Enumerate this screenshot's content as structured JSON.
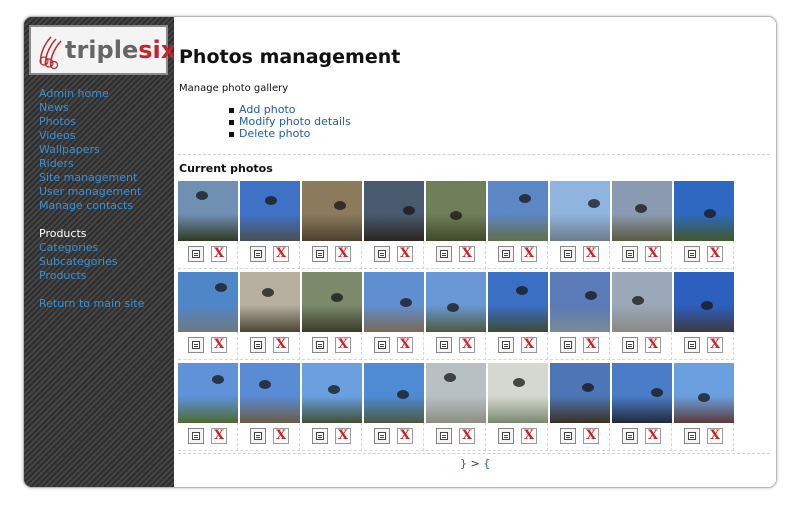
{
  "logo": {
    "text_main": "triple",
    "text_accent": "six"
  },
  "nav": {
    "items": [
      "Admin home",
      "News",
      "Photos",
      "Videos",
      "Wallpapers",
      "Riders",
      "Site management",
      "User management",
      "Manage contacts"
    ],
    "products_heading": "Products",
    "product_items": [
      "Categories",
      "Subcategories",
      "Products"
    ],
    "return_link": "Return to main site"
  },
  "page": {
    "title": "Photos management",
    "subtitle": "Manage photo gallery",
    "actions": [
      "Add photo",
      "Modify photo details",
      "Delete photo"
    ],
    "section_title": "Current photos"
  },
  "photos": {
    "delete_glyph": "X",
    "thumbs": [
      [
        "#6f8fb3",
        "#2f3a22"
      ],
      [
        "#3f72c6",
        "#4a4f55"
      ],
      [
        "#8b7a5c",
        "#4d4030"
      ],
      [
        "#4a5a6e",
        "#2a2520"
      ],
      [
        "#6f7f5a",
        "#3f4a2a"
      ],
      [
        "#5d86c4",
        "#5f6f4a"
      ],
      [
        "#8fb4de",
        "#6d7c8a"
      ],
      [
        "#8a9ab0",
        "#5a5a40"
      ],
      [
        "#2f68c0",
        "#3d5a2a"
      ],
      [
        "#4f86c8",
        "#6f7880"
      ],
      [
        "#b7b0a0",
        "#4a4535"
      ],
      [
        "#7a8a6a",
        "#3a3a2a"
      ],
      [
        "#5f8fd0",
        "#7a6a55"
      ],
      [
        "#6a98d6",
        "#4f5a40"
      ],
      [
        "#3a6fc4",
        "#3f4a3a"
      ],
      [
        "#5a7ab8",
        "#7a8a95"
      ],
      [
        "#9aa8b8",
        "#8a8a85"
      ],
      [
        "#2d5fbf",
        "#3a3a45"
      ],
      [
        "#5f92d8",
        "#4f6a35"
      ],
      [
        "#5a8cd6",
        "#6a5a45"
      ],
      [
        "#6aa0e0",
        "#3f4f35"
      ],
      [
        "#4f8ad4",
        "#4a5a40"
      ],
      [
        "#b9c0c4",
        "#8a8f80"
      ],
      [
        "#d4d8d0",
        "#7a8a70"
      ],
      [
        "#4c76b6",
        "#3a3022"
      ],
      [
        "#4a7cc8",
        "#202a3a"
      ],
      [
        "#6aa0e0",
        "#5a3a3a"
      ]
    ]
  },
  "pager": {
    "prev": "}",
    "sep": ">",
    "next": "{"
  }
}
